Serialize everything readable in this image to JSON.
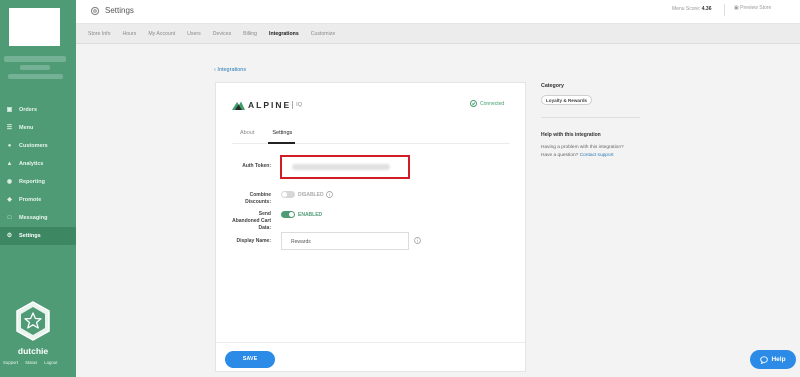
{
  "app": {
    "brand_name": "dutchie",
    "footer_links": [
      "Support",
      "Status",
      "Logout"
    ]
  },
  "sidebar": {
    "items": [
      {
        "label": "Orders",
        "icon": "receipt-icon",
        "active": false
      },
      {
        "label": "Menu",
        "icon": "list-icon",
        "active": false
      },
      {
        "label": "Customers",
        "icon": "users-icon",
        "active": false
      },
      {
        "label": "Analytics",
        "icon": "chart-icon",
        "active": false
      },
      {
        "label": "Reporting",
        "icon": "report-icon",
        "active": false
      },
      {
        "label": "Promote",
        "icon": "tag-icon",
        "active": false
      },
      {
        "label": "Messaging",
        "icon": "message-icon",
        "active": false
      },
      {
        "label": "Settings",
        "icon": "gear-icon",
        "active": true
      }
    ]
  },
  "topbar": {
    "title": "Settings",
    "menu_score_label": "Menu Score:",
    "menu_score_value": "4.36",
    "preview_label": "Preview Store"
  },
  "subtabs": {
    "items": [
      "Store Info",
      "Hours",
      "My Account",
      "Users",
      "Devices",
      "Billing",
      "Integrations",
      "Customize"
    ],
    "active": "Integrations"
  },
  "integration": {
    "back_label": "Integrations",
    "logo_word": "ALPINE",
    "logo_suffix": "IQ",
    "status": "Connected",
    "tabs": [
      "About",
      "Settings"
    ],
    "active_tab": "Settings",
    "fields": {
      "auth_token_label": "Auth Token:",
      "combine_discounts_label": "Combine Discounts:",
      "combine_discounts_state": "DISABLED",
      "send_abandoned_label": "Send Abandoned Cart Data:",
      "send_abandoned_state": "ENABLED",
      "display_name_label": "Display Name:",
      "display_name_value": "Rewards"
    },
    "save_label": "SAVE"
  },
  "info_panel": {
    "category_label": "Category",
    "category_value": "Loyalty & Rewards",
    "help_title": "Help with this integration",
    "help_line1": "Having a problem with this integration?",
    "help_line2_prefix": "Have a question?",
    "help_link": "Contact support"
  },
  "help_button": {
    "label": "Help"
  },
  "colors": {
    "sidebar": "#4f9b76",
    "accent_blue": "#2b8be6",
    "highlight_red": "#d21d24",
    "connected_green": "#3f9e6b"
  }
}
